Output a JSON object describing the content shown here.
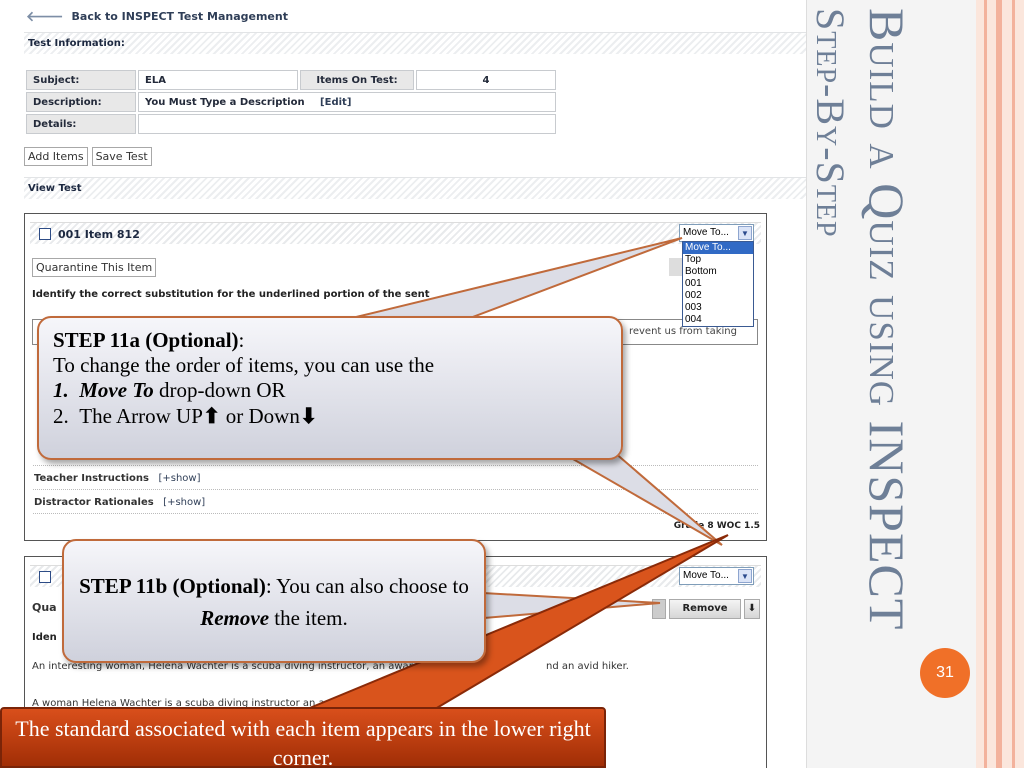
{
  "back_link": "Back to INSPECT Test Management",
  "sections": {
    "test_information": "Test Information:",
    "view_test": "View Test"
  },
  "test_info": {
    "subject_label": "Subject:",
    "subject_value": "ELA",
    "items_label": "Items On Test:",
    "items_value": "4",
    "description_label": "Description:",
    "description_value": "You Must Type a Description",
    "edit_label": "[Edit]",
    "details_label": "Details:",
    "details_value": ""
  },
  "actions": {
    "add_items": "Add Items",
    "save_test": "Save Test"
  },
  "item1": {
    "title": "001 Item 812",
    "move_select": "Move To...",
    "quarantine": "Quarantine This Item",
    "question": "Identify the correct substitution for the underlined portion of the sent",
    "answer_tail": "revent us from taking",
    "teacher_instructions": "Teacher Instructions",
    "distractor_rationales": "Distractor Rationales",
    "show_label": "[+show]",
    "standard": "Grade 8 WOC 1.5"
  },
  "move_options": [
    "Move To...",
    "Top",
    "Bottom",
    "001",
    "002",
    "003",
    "004"
  ],
  "item2": {
    "move_select": "Move To...",
    "partial_quarantine": "Qua",
    "partial_question": "Iden",
    "remove": "Remove",
    "down_arrow": "⬇",
    "text1": "An interesting woman, Helena Wachter is a scuba diving instructor, an award",
    "text1_tail": "nd an avid hiker.",
    "text2": "A woman Helena Wachter is a scuba diving instructor an aw"
  },
  "callout_a": {
    "heading": "STEP 11a (Optional)",
    "heading_suffix": ":",
    "line1": "To change the order of items, you can use the",
    "item1_num": "1.",
    "item1_em": "Move To",
    "item1_rest": " drop-down  OR",
    "item2_num": "2.",
    "item2_text": "The Arrow UP",
    "up_arrow": "⬆",
    "item2_mid": "  or Down",
    "down_arrow": "⬇"
  },
  "callout_b": {
    "heading": "STEP 11b (Optional)",
    "text1": ": You can also choose to ",
    "em": "Remove",
    "text2": "  the item."
  },
  "footer_note": "The standard associated with each item appears in the lower right corner.",
  "slide": {
    "title": "Build a Quiz using INSPECT",
    "subtitle": "Step-By-Step",
    "page_number": "31"
  },
  "colors": {
    "title": "#6e7f97",
    "accent": "#f07028",
    "callout_border": "#c06a3b",
    "banner": "#c4420f"
  }
}
